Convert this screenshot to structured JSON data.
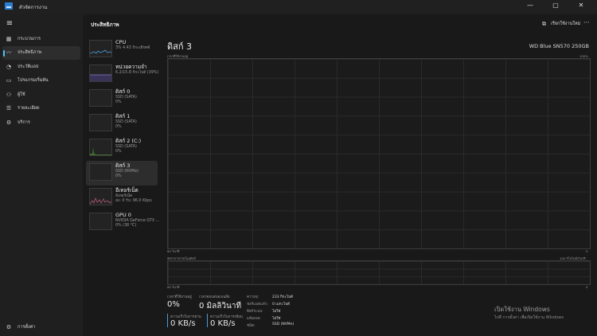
{
  "window": {
    "title": "ตัวจัดการงาน",
    "minimize": "—",
    "maximize": "▢",
    "close": "✕"
  },
  "nav": {
    "menu_icon": "hamburger-icon",
    "items": [
      {
        "label": "กระบวนการ",
        "icon": "grid-icon"
      },
      {
        "label": "ประสิทธิภาพ",
        "icon": "performance-icon"
      },
      {
        "label": "ประวัติแอป",
        "icon": "history-icon"
      },
      {
        "label": "โปรแกรมเริ่มต้น",
        "icon": "startup-icon"
      },
      {
        "label": "ผู้ใช้",
        "icon": "users-icon"
      },
      {
        "label": "รายละเอียด",
        "icon": "details-icon"
      },
      {
        "label": "บริการ",
        "icon": "services-icon"
      }
    ],
    "settings_label": "การตั้งค่า"
  },
  "header": {
    "page_title": "ประสิทธิภาพ",
    "run_task_label": "เรียกใช้งานใหม่",
    "more": "···"
  },
  "devices": [
    {
      "name": "CPU",
      "sub1": "3% 4.43 กิกะเฮิรตซ์",
      "sub2": "",
      "accent": "#4a9bd9"
    },
    {
      "name": "หน่วยความจำ",
      "sub1": "6.2/15.8 กิกะไบต์ (39%)",
      "sub2": "",
      "accent": "#8e7cc3"
    },
    {
      "name": "ดิสก์ 0",
      "sub1": "SSD (SATA)",
      "sub2": "0%",
      "accent": "#6ab04c"
    },
    {
      "name": "ดิสก์ 1",
      "sub1": "SSD (SATA)",
      "sub2": "0%",
      "accent": "#6ab04c"
    },
    {
      "name": "ดิสก์ 2 (C:)",
      "sub1": "SSD (SATA)",
      "sub2": "0%",
      "accent": "#6ab04c"
    },
    {
      "name": "ดิสก์ 3",
      "sub1": "SSD (NVMe)",
      "sub2": "0%",
      "accent": "#6ab04c"
    },
    {
      "name": "อีเทอร์เน็ต",
      "sub1": "อีเทอร์เน็ต",
      "sub2": "ส่ง: 0 รับ: 96.0 Kbps",
      "accent": "#c06080"
    },
    {
      "name": "GPU 0",
      "sub1": "NVIDIA GeForce GTX ...",
      "sub2": "0% (38 °C)",
      "accent": "#4a9bd9"
    }
  ],
  "detail": {
    "title": "ดิสก์ 3",
    "model": "WD Blue SN570 250GB",
    "graph1_label": "เวลาที่ใช้งานอยู่",
    "graph1_max": "100%",
    "graph1_time": "60 วินาที",
    "graph1_min": "0",
    "graph2_label": "อัตราการถ่ายโอนดิสก์",
    "graph2_max": "100 กิโลไบต์/วินาที",
    "graph2_time": "60 วินาที",
    "graph2_min": "0",
    "active_time_label": "เวลาที่ใช้งานอยู่",
    "active_time_value": "0%",
    "avg_response_label": "เวลาตอบสนองเฉลี่ย",
    "avg_response_value": "0 มิลลิวินาที",
    "read_speed_label": "ความเร็วในการอ่าน",
    "read_speed_value": "0 KB/s",
    "write_speed_label": "ความเร็วในการเขียน",
    "write_speed_value": "0 KB/s",
    "props": [
      {
        "key": "ความจุ:",
        "value": "233 กิกะไบต์"
      },
      {
        "key": "ฟอร์แมตแล้ว:",
        "value": "0 เมกะไบต์"
      },
      {
        "key": "ดิสก์ระบบ:",
        "value": "ไม่ใช่"
      },
      {
        "key": "แฟ้มเพจ:",
        "value": "ไม่ใช่"
      },
      {
        "key": "ชนิด:",
        "value": "SSD (NVMe)"
      }
    ]
  },
  "watermark": {
    "line1": "เปิดใช้งาน Windows",
    "line2": "ไปที่ การตั้งค่า เพื่อเปิดใช้งาน Windows"
  }
}
